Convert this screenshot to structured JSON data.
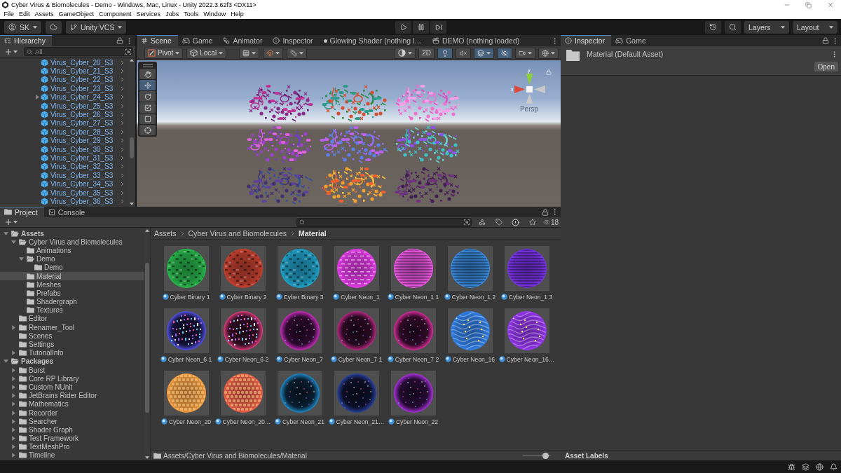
{
  "window": {
    "title": "Cyber Virus & Biomolecules - Demo - Windows, Mac, Linux - Unity 2022.3.62f3 <DX11>"
  },
  "menu_bar": [
    "File",
    "Edit",
    "Assets",
    "GameObject",
    "Component",
    "Services",
    "Jobs",
    "Tools",
    "Window",
    "Help"
  ],
  "toolbar": {
    "account": "SK",
    "version_control": "Unity VCS",
    "layers": "Layers",
    "layout": "Layout"
  },
  "hierarchy": {
    "tab": "Hierarchy",
    "search": {
      "placeholder": "All"
    },
    "items": [
      {
        "label": "Virus_Cyber_20_S3"
      },
      {
        "label": "Virus_Cyber_21_S3"
      },
      {
        "label": "Virus_Cyber_22_S3"
      },
      {
        "label": "Virus_Cyber_23_S3"
      },
      {
        "label": "Virus_Cyber_24_S3",
        "expanded": false
      },
      {
        "label": "Virus_Cyber_25_S3"
      },
      {
        "label": "Virus_Cyber_26_S3"
      },
      {
        "label": "Virus_Cyber_27_S3"
      },
      {
        "label": "Virus_Cyber_28_S3"
      },
      {
        "label": "Virus_Cyber_29_S3"
      },
      {
        "label": "Virus_Cyber_30_S3"
      },
      {
        "label": "Virus_Cyber_31_S3"
      },
      {
        "label": "Virus_Cyber_32_S3"
      },
      {
        "label": "Virus_Cyber_33_S3"
      },
      {
        "label": "Virus_Cyber_34_S3"
      },
      {
        "label": "Virus_Cyber_35_S3"
      },
      {
        "label": "Virus_Cyber_36_S3"
      }
    ]
  },
  "scene": {
    "tabs": [
      {
        "kind": "scene",
        "label": "Scene",
        "selected": true
      },
      {
        "kind": "game",
        "label": "Game",
        "selected": false
      },
      {
        "kind": "animator",
        "label": "Animator",
        "selected": false
      },
      {
        "kind": "inspector",
        "label": "Inspector",
        "selected": false
      },
      {
        "kind": "shader",
        "label": "Glowing Shader (nothing l…",
        "selected": false
      },
      {
        "kind": "timeline",
        "label": "DEMO (nothing loaded)",
        "selected": false
      }
    ],
    "pivot": "Pivot",
    "handle_space": "Local",
    "view_options": [
      {
        "kind": "shading",
        "on": false
      },
      {
        "kind": "dimension",
        "label": "2D",
        "on": false
      },
      {
        "kind": "lighting",
        "on": true
      },
      {
        "kind": "audio",
        "on": false
      },
      {
        "kind": "effects",
        "on": true
      },
      {
        "kind": "visibility",
        "on": true
      },
      {
        "kind": "camera",
        "on": false
      },
      {
        "kind": "gizmos",
        "on": false
      }
    ],
    "tools": [
      {
        "kind": "hand",
        "selected": false
      },
      {
        "kind": "move",
        "selected": true
      },
      {
        "kind": "rotate",
        "selected": false
      },
      {
        "kind": "scale",
        "selected": false
      },
      {
        "kind": "rect",
        "selected": false
      },
      {
        "kind": "transform",
        "selected": false
      }
    ],
    "gizmo": {
      "x_axis": "x",
      "y_axis": "y",
      "projection": "Persp"
    }
  },
  "project": {
    "tabs": [
      {
        "kind": "project",
        "label": "Project",
        "selected": true
      },
      {
        "kind": "console",
        "label": "Console",
        "selected": false
      }
    ],
    "visible_count": "18",
    "tree": [
      {
        "label": "Assets",
        "expanded": true,
        "selected": false,
        "children": [
          {
            "label": "Cyber Virus and Biomolecules",
            "expanded": true,
            "selected": false,
            "children": [
              {
                "label": "Animations",
                "selected": false
              },
              {
                "label": "Demo",
                "expanded": true,
                "selected": false,
                "children": [
                  {
                    "label": "Demo",
                    "selected": false
                  }
                ]
              },
              {
                "label": "Material",
                "selected": true
              },
              {
                "label": "Meshes",
                "selected": false
              },
              {
                "label": "Prefabs",
                "selected": false
              },
              {
                "label": "Shadergraph",
                "selected": false
              },
              {
                "label": "Textures",
                "selected": false
              }
            ]
          },
          {
            "label": "Editor",
            "selected": false
          },
          {
            "label": "Renamer_Tool",
            "expanded": false,
            "selected": false
          },
          {
            "label": "Scenes",
            "selected": false
          },
          {
            "label": "Settings",
            "selected": false
          },
          {
            "label": "TutorialInfo",
            "expanded": false,
            "selected": false
          }
        ]
      },
      {
        "label": "Packages",
        "expanded": true,
        "selected": false,
        "children": [
          {
            "label": "Burst",
            "expanded": false,
            "selected": false
          },
          {
            "label": "Core RP Library",
            "expanded": false,
            "selected": false
          },
          {
            "label": "Custom NUnit",
            "expanded": false,
            "selected": false
          },
          {
            "label": "JetBrains Rider Editor",
            "expanded": false,
            "selected": false
          },
          {
            "label": "Mathematics",
            "expanded": false,
            "selected": false
          },
          {
            "label": "Recorder",
            "expanded": false,
            "selected": false
          },
          {
            "label": "Searcher",
            "expanded": false,
            "selected": false
          },
          {
            "label": "Shader Graph",
            "expanded": false,
            "selected": false
          },
          {
            "label": "Test Framework",
            "expanded": false,
            "selected": false
          },
          {
            "label": "TextMeshPro",
            "expanded": false,
            "selected": false
          },
          {
            "label": "Timeline",
            "expanded": false,
            "selected": false
          }
        ]
      }
    ],
    "breadcrumb": [
      "Assets",
      "Cyber Virus and Biomolecules",
      "Material"
    ],
    "assets": [
      {
        "name": "Cyber Binary 1",
        "kind": "binary",
        "color": "#27b34a"
      },
      {
        "name": "Cyber Binary 2",
        "kind": "binary",
        "color": "#c2402e"
      },
      {
        "name": "Cyber Binary 3",
        "kind": "binary",
        "color": "#1f9fc4"
      },
      {
        "name": "Cyber Neon_1",
        "kind": "dashes",
        "color": "#e23ae6"
      },
      {
        "name": "Cyber Neon_1 1",
        "kind": "stripes",
        "color": "#f15ae8"
      },
      {
        "name": "Cyber Neon_1 2",
        "kind": "stripes",
        "color": "#3b8de0"
      },
      {
        "name": "Cyber Neon_1 3",
        "kind": "stripes",
        "color": "#7b35ea"
      },
      {
        "name": "Cyber Neon_6 1",
        "kind": "sparkles",
        "color": "#4f4fe0"
      },
      {
        "name": "Cyber Neon_6 2",
        "kind": "sparkles",
        "color": "#d63a78"
      },
      {
        "name": "Cyber Neon_7",
        "kind": "dark",
        "color": "#c42ab8"
      },
      {
        "name": "Cyber Neon_7 1",
        "kind": "dark",
        "color": "#b3277e"
      },
      {
        "name": "Cyber Neon_7 2",
        "kind": "dark",
        "color": "#d12a94"
      },
      {
        "name": "Cyber Neon_16",
        "kind": "swirl",
        "color": "#2f7fe6"
      },
      {
        "name": "Cyber Neon_16…",
        "kind": "swirl",
        "color": "#9436ee"
      },
      {
        "name": "Cyber Neon_20",
        "kind": "cells",
        "color": "#ee9a3e"
      },
      {
        "name": "Cyber Neon_20…",
        "kind": "cells",
        "color": "#e75c45"
      },
      {
        "name": "Cyber Neon_21",
        "kind": "dark",
        "color": "#1d86c2"
      },
      {
        "name": "Cyber Neon_21…",
        "kind": "dark",
        "color": "#27409a"
      },
      {
        "name": "Cyber Neon_22",
        "kind": "dark",
        "color": "#a52fd6"
      }
    ],
    "path": "Assets/Cyber Virus and Biomolecules/Material",
    "thumbnail_size": {
      "level": 0.82
    }
  },
  "inspector": {
    "tabs": [
      {
        "kind": "inspector",
        "label": "Inspector",
        "selected": true
      },
      {
        "kind": "game",
        "label": "Game",
        "selected": false
      }
    ],
    "title": "Material (Default Asset)",
    "open_button": "Open",
    "footer": "Asset Labels"
  }
}
